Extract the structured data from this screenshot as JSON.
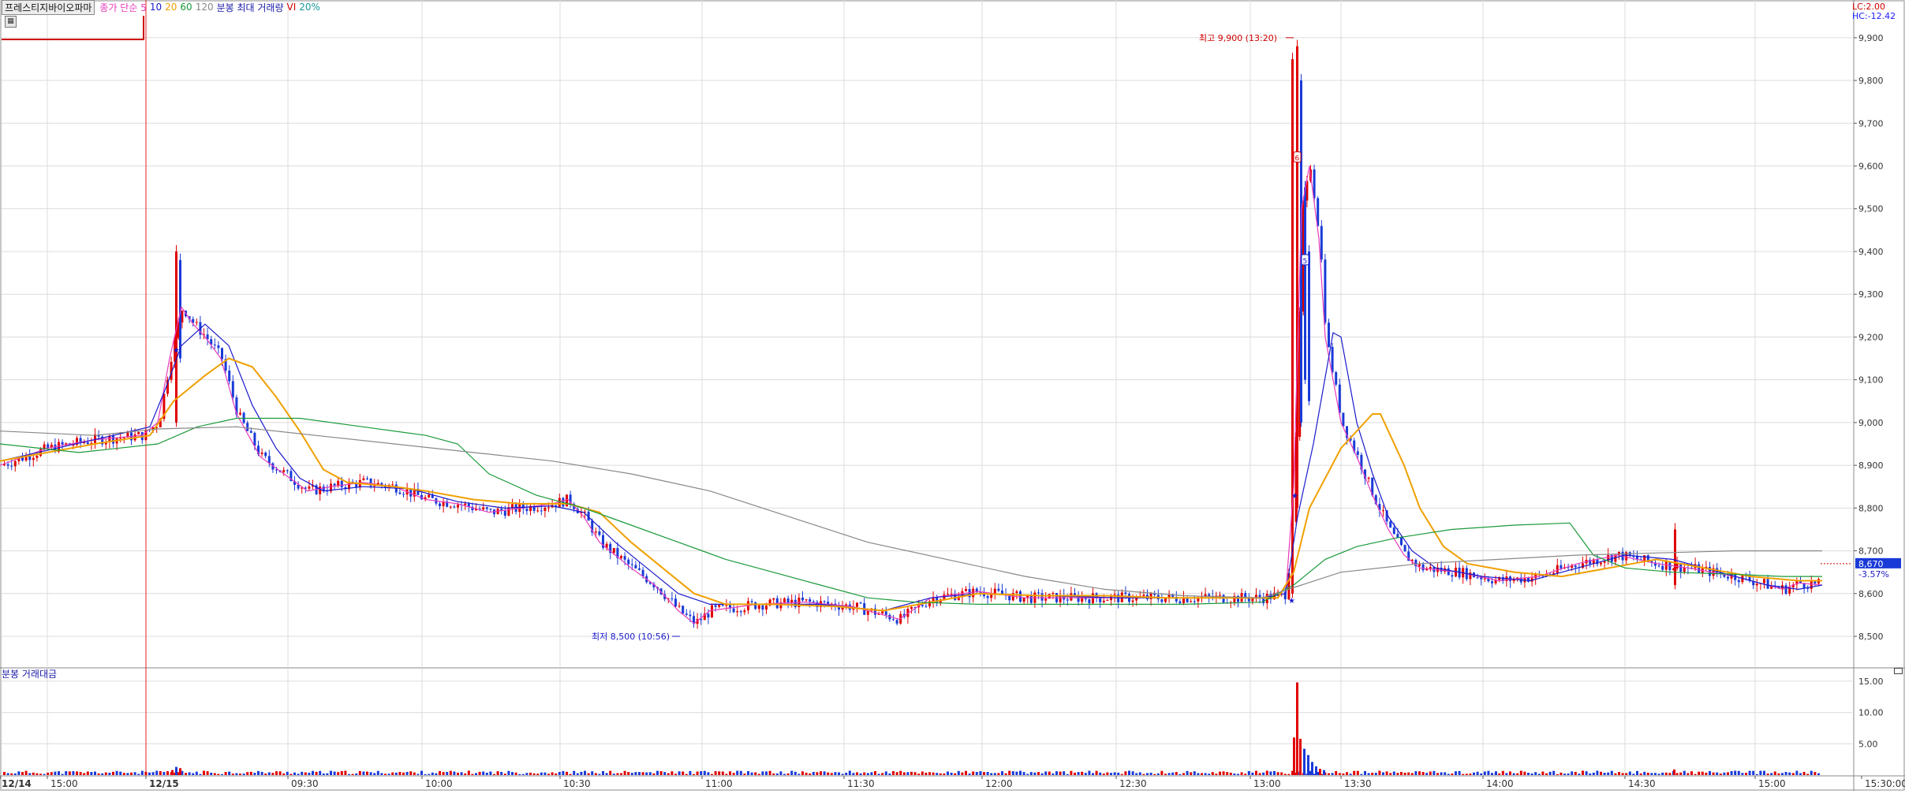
{
  "header": {
    "stock_name": "프레스티지바이오파마",
    "legend": [
      {
        "text": "종가 단순 5",
        "color": "#e83cbd"
      },
      {
        "text": "10",
        "color": "#1a1acc"
      },
      {
        "text": "20",
        "color": "#f0a000"
      },
      {
        "text": "60",
        "color": "#1a9a3a"
      },
      {
        "text": "120",
        "color": "#888888"
      },
      {
        "text": "분봉 최대 거래량",
        "color": "#1a1aa8"
      },
      {
        "text": "VI",
        "color": "#d00000"
      },
      {
        "text": "20%",
        "color": "#1a9a9a"
      }
    ]
  },
  "side_labels": {
    "lc": "LC:2.00",
    "hc": "HC:-12.42"
  },
  "current": {
    "price": "8,670",
    "change": "-3.57%"
  },
  "volume_panel": {
    "title": "분봉 거래대금"
  },
  "colors": {
    "up": "#e00000",
    "down": "#1a3ad8",
    "grid": "#dcdcdc",
    "axis": "#555555"
  },
  "chart_data": [
    {
      "type": "candlestick",
      "title": "",
      "y_ticks": [
        "9,900",
        "9,800",
        "9,700",
        "9,600",
        "9,500",
        "9,400",
        "9,300",
        "9,200",
        "9,100",
        "9,000",
        "8,900",
        "8,800",
        "8,700",
        "8,600",
        "8,500"
      ],
      "ylim": [
        8430,
        9955
      ],
      "x_ticks": [
        "12/14",
        "15:00",
        "12/15",
        "09:30",
        "10:00",
        "10:30",
        "11:00",
        "11:30",
        "12:00",
        "12:30",
        "13:00",
        "13:30",
        "14:00",
        "14:30",
        "15:00",
        "15:30:00"
      ],
      "grid": true,
      "annotations": [
        {
          "text": "최고 9,900 (13:20)",
          "value": 9900,
          "color": "#d00000"
        },
        {
          "text": "최저 8,500 (10:56)",
          "value": 8500,
          "color": "#1a1acc"
        }
      ],
      "vi_markers": [
        "6",
        "5"
      ],
      "series": [
        {
          "name": "5",
          "color": "#e83cbd",
          "points": [
            [
              0,
              8900
            ],
            [
              60,
              8940
            ],
            [
              120,
              8960
            ],
            [
              180,
              8970
            ],
            [
              200,
              9000
            ],
            [
              215,
              9150
            ],
            [
              230,
              9270
            ],
            [
              245,
              9230
            ],
            [
              260,
              9200
            ],
            [
              280,
              9150
            ],
            [
              300,
              9020
            ],
            [
              330,
              8920
            ],
            [
              360,
              8880
            ],
            [
              390,
              8840
            ],
            [
              420,
              8850
            ],
            [
              460,
              8860
            ],
            [
              500,
              8850
            ],
            [
              540,
              8820
            ],
            [
              580,
              8810
            ],
            [
              620,
              8790
            ],
            [
              660,
              8800
            ],
            [
              700,
              8810
            ],
            [
              720,
              8820
            ],
            [
              740,
              8780
            ],
            [
              760,
              8720
            ],
            [
              800,
              8660
            ],
            [
              830,
              8620
            ],
            [
              860,
              8560
            ],
            [
              880,
              8530
            ],
            [
              900,
              8560
            ],
            [
              960,
              8575
            ],
            [
              1020,
              8580
            ],
            [
              1080,
              8570
            ],
            [
              1120,
              8550
            ],
            [
              1140,
              8540
            ],
            [
              1180,
              8590
            ],
            [
              1240,
              8605
            ],
            [
              1300,
              8590
            ],
            [
              1380,
              8590
            ],
            [
              1460,
              8590
            ],
            [
              1540,
              8590
            ],
            [
              1600,
              8590
            ],
            [
              1630,
              8600
            ],
            [
              1640,
              8850
            ],
            [
              1650,
              9500
            ],
            [
              1660,
              9600
            ],
            [
              1672,
              9430
            ],
            [
              1680,
              9200
            ],
            [
              1700,
              9000
            ],
            [
              1720,
              8920
            ],
            [
              1740,
              8830
            ],
            [
              1760,
              8750
            ],
            [
              1780,
              8690
            ],
            [
              1800,
              8660
            ],
            [
              1850,
              8650
            ],
            [
              1900,
              8630
            ],
            [
              1950,
              8640
            ],
            [
              2000,
              8670
            ],
            [
              2050,
              8690
            ],
            [
              2100,
              8670
            ],
            [
              2140,
              8660
            ],
            [
              2200,
              8640
            ],
            [
              2260,
              8610
            ],
            [
              2280,
              8625
            ],
            [
              2310,
              8620
            ]
          ]
        },
        {
          "name": "10",
          "color": "#1a1acc",
          "points": [
            [
              0,
              8910
            ],
            [
              120,
              8960
            ],
            [
              190,
              8990
            ],
            [
              210,
              9080
            ],
            [
              230,
              9180
            ],
            [
              260,
              9230
            ],
            [
              290,
              9180
            ],
            [
              320,
              9040
            ],
            [
              350,
              8940
            ],
            [
              380,
              8870
            ],
            [
              410,
              8840
            ],
            [
              460,
              8850
            ],
            [
              520,
              8845
            ],
            [
              580,
              8815
            ],
            [
              640,
              8800
            ],
            [
              700,
              8805
            ],
            [
              740,
              8790
            ],
            [
              780,
              8720
            ],
            [
              820,
              8660
            ],
            [
              860,
              8600
            ],
            [
              900,
              8575
            ],
            [
              960,
              8575
            ],
            [
              1040,
              8575
            ],
            [
              1120,
              8560
            ],
            [
              1180,
              8590
            ],
            [
              1240,
              8600
            ],
            [
              1320,
              8595
            ],
            [
              1420,
              8590
            ],
            [
              1520,
              8590
            ],
            [
              1600,
              8590
            ],
            [
              1630,
              8600
            ],
            [
              1645,
              8780
            ],
            [
              1665,
              8950
            ],
            [
              1690,
              9210
            ],
            [
              1700,
              9200
            ],
            [
              1720,
              9000
            ],
            [
              1740,
              8880
            ],
            [
              1760,
              8780
            ],
            [
              1790,
              8700
            ],
            [
              1820,
              8660
            ],
            [
              1880,
              8640
            ],
            [
              1940,
              8630
            ],
            [
              2000,
              8660
            ],
            [
              2060,
              8690
            ],
            [
              2120,
              8680
            ],
            [
              2180,
              8650
            ],
            [
              2240,
              8620
            ],
            [
              2280,
              8610
            ],
            [
              2310,
              8620
            ]
          ]
        },
        {
          "name": "20",
          "color": "#f0a000",
          "points": [
            [
              0,
              8910
            ],
            [
              120,
              8950
            ],
            [
              190,
              8970
            ],
            [
              220,
              9050
            ],
            [
              260,
              9110
            ],
            [
              290,
              9150
            ],
            [
              320,
              9130
            ],
            [
              350,
              9060
            ],
            [
              380,
              8980
            ],
            [
              410,
              8890
            ],
            [
              440,
              8860
            ],
            [
              500,
              8850
            ],
            [
              540,
              8840
            ],
            [
              600,
              8820
            ],
            [
              660,
              8810
            ],
            [
              720,
              8810
            ],
            [
              760,
              8790
            ],
            [
              800,
              8720
            ],
            [
              840,
              8660
            ],
            [
              880,
              8600
            ],
            [
              920,
              8575
            ],
            [
              980,
              8575
            ],
            [
              1060,
              8570
            ],
            [
              1120,
              8560
            ],
            [
              1180,
              8580
            ],
            [
              1240,
              8600
            ],
            [
              1320,
              8595
            ],
            [
              1400,
              8595
            ],
            [
              1480,
              8590
            ],
            [
              1560,
              8590
            ],
            [
              1620,
              8590
            ],
            [
              1640,
              8650
            ],
            [
              1660,
              8800
            ],
            [
              1700,
              8940
            ],
            [
              1740,
              9020
            ],
            [
              1750,
              9020
            ],
            [
              1780,
              8900
            ],
            [
              1800,
              8800
            ],
            [
              1830,
              8710
            ],
            [
              1860,
              8670
            ],
            [
              1920,
              8650
            ],
            [
              1980,
              8640
            ],
            [
              2040,
              8660
            ],
            [
              2100,
              8680
            ],
            [
              2160,
              8660
            ],
            [
              2220,
              8640
            ],
            [
              2280,
              8630
            ],
            [
              2310,
              8630
            ]
          ]
        },
        {
          "name": "60",
          "color": "#1a9a3a",
          "points": [
            [
              0,
              8950
            ],
            [
              100,
              8930
            ],
            [
              200,
              8950
            ],
            [
              250,
              8990
            ],
            [
              300,
              9010
            ],
            [
              380,
              9010
            ],
            [
              460,
              8990
            ],
            [
              540,
              8970
            ],
            [
              580,
              8950
            ],
            [
              620,
              8880
            ],
            [
              680,
              8830
            ],
            [
              740,
              8800
            ],
            [
              800,
              8760
            ],
            [
              860,
              8720
            ],
            [
              920,
              8680
            ],
            [
              980,
              8650
            ],
            [
              1040,
              8620
            ],
            [
              1100,
              8590
            ],
            [
              1160,
              8580
            ],
            [
              1240,
              8575
            ],
            [
              1320,
              8575
            ],
            [
              1400,
              8575
            ],
            [
              1500,
              8575
            ],
            [
              1600,
              8580
            ],
            [
              1640,
              8620
            ],
            [
              1680,
              8680
            ],
            [
              1720,
              8710
            ],
            [
              1770,
              8730
            ],
            [
              1840,
              8750
            ],
            [
              1920,
              8760
            ],
            [
              1990,
              8765
            ],
            [
              2000,
              8740
            ],
            [
              2020,
              8690
            ],
            [
              2060,
              8660
            ],
            [
              2120,
              8650
            ],
            [
              2200,
              8645
            ],
            [
              2260,
              8640
            ],
            [
              2310,
              8640
            ]
          ]
        },
        {
          "name": "120",
          "color": "#888888",
          "points": [
            [
              0,
              8980
            ],
            [
              120,
              8970
            ],
            [
              200,
              8985
            ],
            [
              300,
              8990
            ],
            [
              400,
              8970
            ],
            [
              500,
              8950
            ],
            [
              600,
              8930
            ],
            [
              700,
              8910
            ],
            [
              800,
              8880
            ],
            [
              900,
              8840
            ],
            [
              1000,
              8780
            ],
            [
              1100,
              8720
            ],
            [
              1200,
              8680
            ],
            [
              1300,
              8640
            ],
            [
              1400,
              8610
            ],
            [
              1500,
              8595
            ],
            [
              1600,
              8590
            ],
            [
              1650,
              8620
            ],
            [
              1700,
              8650
            ],
            [
              1800,
              8670
            ],
            [
              1900,
              8680
            ],
            [
              2000,
              8690
            ],
            [
              2100,
              8695
            ],
            [
              2200,
              8700
            ],
            [
              2310,
              8700
            ]
          ]
        }
      ]
    },
    {
      "type": "bar",
      "title": "분봉 거래대금",
      "y_ticks": [
        "15.00",
        "10.00",
        "5.00"
      ],
      "ylim": [
        0,
        16.5
      ],
      "spikes": [
        {
          "x": 1639,
          "value": 6.0,
          "dir": "up"
        },
        {
          "x": 1643,
          "value": 14.8,
          "dir": "up"
        },
        {
          "x": 1647,
          "value": 5.8,
          "dir": "up"
        },
        {
          "x": 1652,
          "value": 4.2,
          "dir": "down"
        },
        {
          "x": 1657,
          "value": 3.2,
          "dir": "down"
        },
        {
          "x": 1662,
          "value": 2.1,
          "dir": "down"
        },
        {
          "x": 1667,
          "value": 1.4,
          "dir": "down"
        },
        {
          "x": 1672,
          "value": 1.0,
          "dir": "up"
        },
        {
          "x": 1677,
          "value": 0.8,
          "dir": "down"
        },
        {
          "x": 222,
          "value": 1.3,
          "dir": "down"
        },
        {
          "x": 227,
          "value": 1.1,
          "dir": "up"
        },
        {
          "x": 217,
          "value": 0.8,
          "dir": "up"
        },
        {
          "x": 2121,
          "value": 0.9,
          "dir": "up"
        },
        {
          "x": 1798,
          "value": 0.6,
          "dir": "up"
        },
        {
          "x": 1895,
          "value": 0.6,
          "dir": "down"
        }
      ]
    }
  ]
}
